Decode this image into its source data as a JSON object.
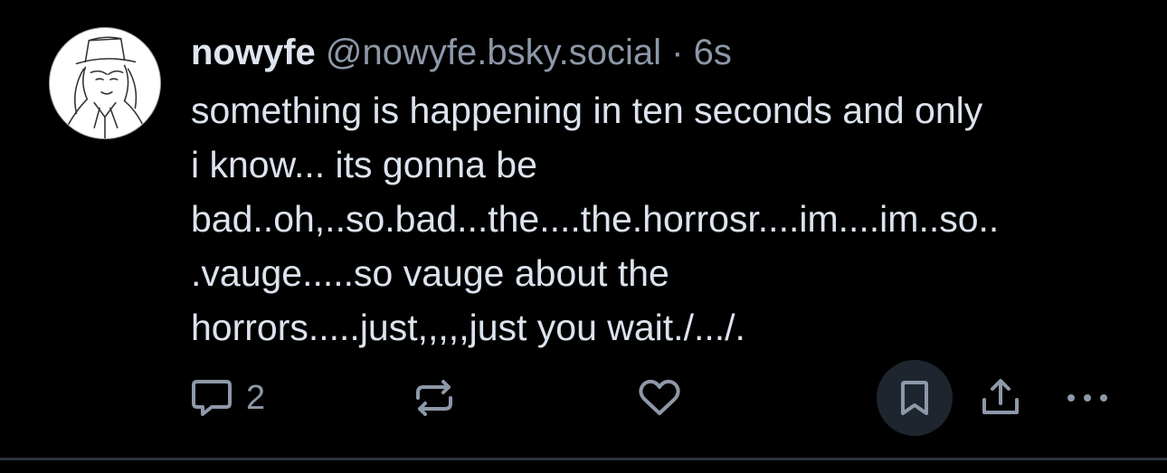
{
  "post": {
    "author": {
      "display_name": "nowyfe",
      "handle": "@nowyfe.bsky.social"
    },
    "separator": "·",
    "time": "6s",
    "text": "something is happening in ten seconds and only\ni know... its gonna be\nbad..oh,..so.bad...the....the.horrosr....im....im..so..\n.vauge.....so vauge about the\nhorrors.....just,,,,,just you wait./.../.",
    "reply_count": "2"
  },
  "icons": {
    "reply": "speech-bubble-icon",
    "repost": "repost-arrows-icon",
    "like": "heart-icon",
    "bookmark": "bookmark-icon",
    "share": "share-upload-icon",
    "more": "ellipsis-icon"
  },
  "colors": {
    "background": "#000000",
    "text": "#dde3ee",
    "muted": "#8d98a8",
    "bookmark_bg": "#1e252e",
    "divider": "#2a313b"
  }
}
